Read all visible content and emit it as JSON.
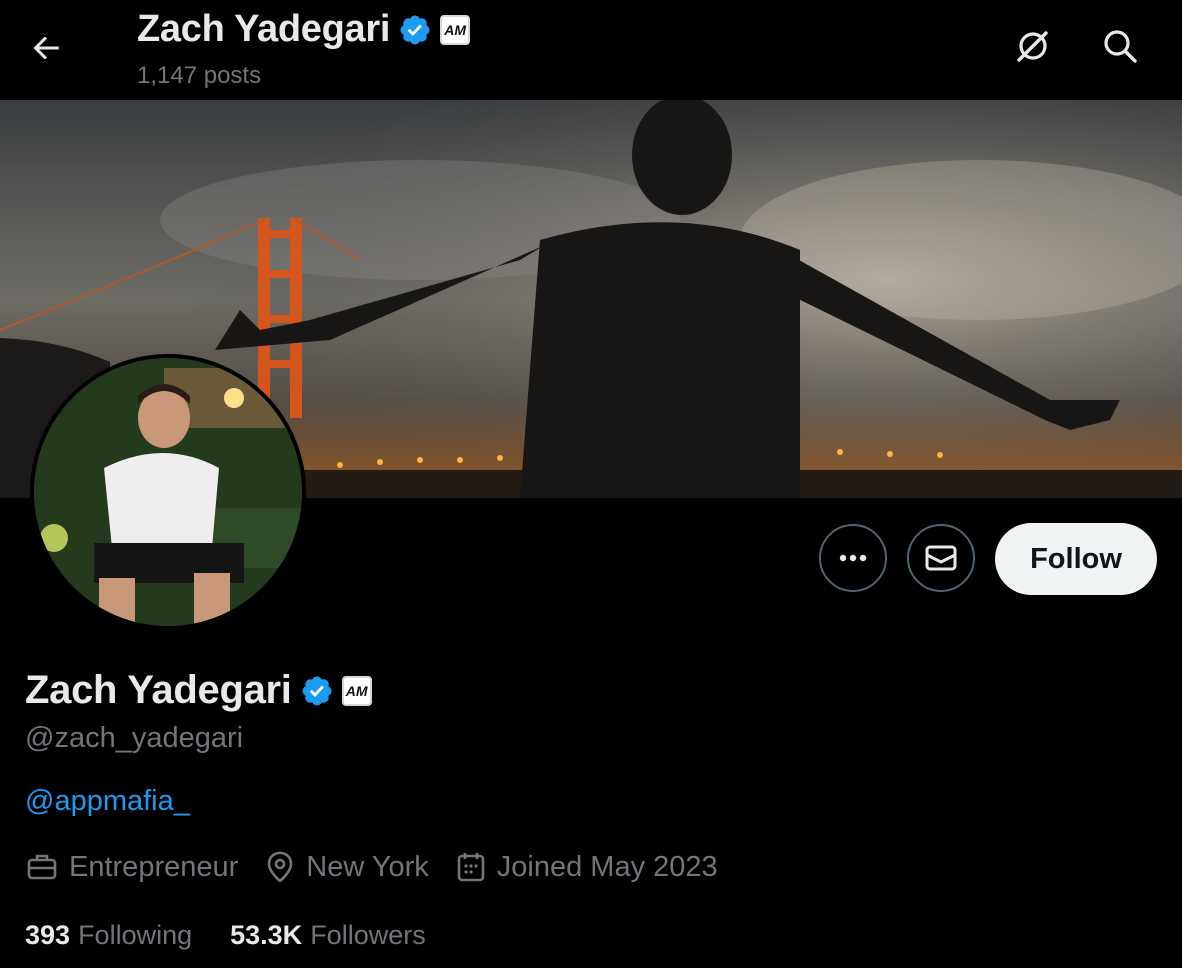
{
  "header": {
    "name": "Zach Yadegari",
    "posts_count": "1,147 posts",
    "org_badge_text": "AM"
  },
  "icons": {
    "back": "arrow-left-icon",
    "grok": "grok-icon",
    "search": "search-icon",
    "verified": "verified-badge-icon",
    "more": "more-icon",
    "message": "envelope-icon",
    "profession": "briefcase-icon",
    "location": "location-pin-icon",
    "joined": "calendar-icon"
  },
  "actions": {
    "follow_label": "Follow"
  },
  "profile": {
    "name": "Zach Yadegari",
    "handle": "@zach_yadegari",
    "bio_link": "@appmafia_",
    "profession": "Entrepreneur",
    "location": "New York",
    "joined": "Joined May 2023"
  },
  "stats": {
    "following_count": "393",
    "following_label": "Following",
    "followers_count": "53.3K",
    "followers_label": "Followers"
  },
  "colors": {
    "background": "#000000",
    "text_primary": "#e7e9ea",
    "text_secondary": "#71767b",
    "accent": "#1d9bf0",
    "follow_button_bg": "#eff3f4"
  }
}
